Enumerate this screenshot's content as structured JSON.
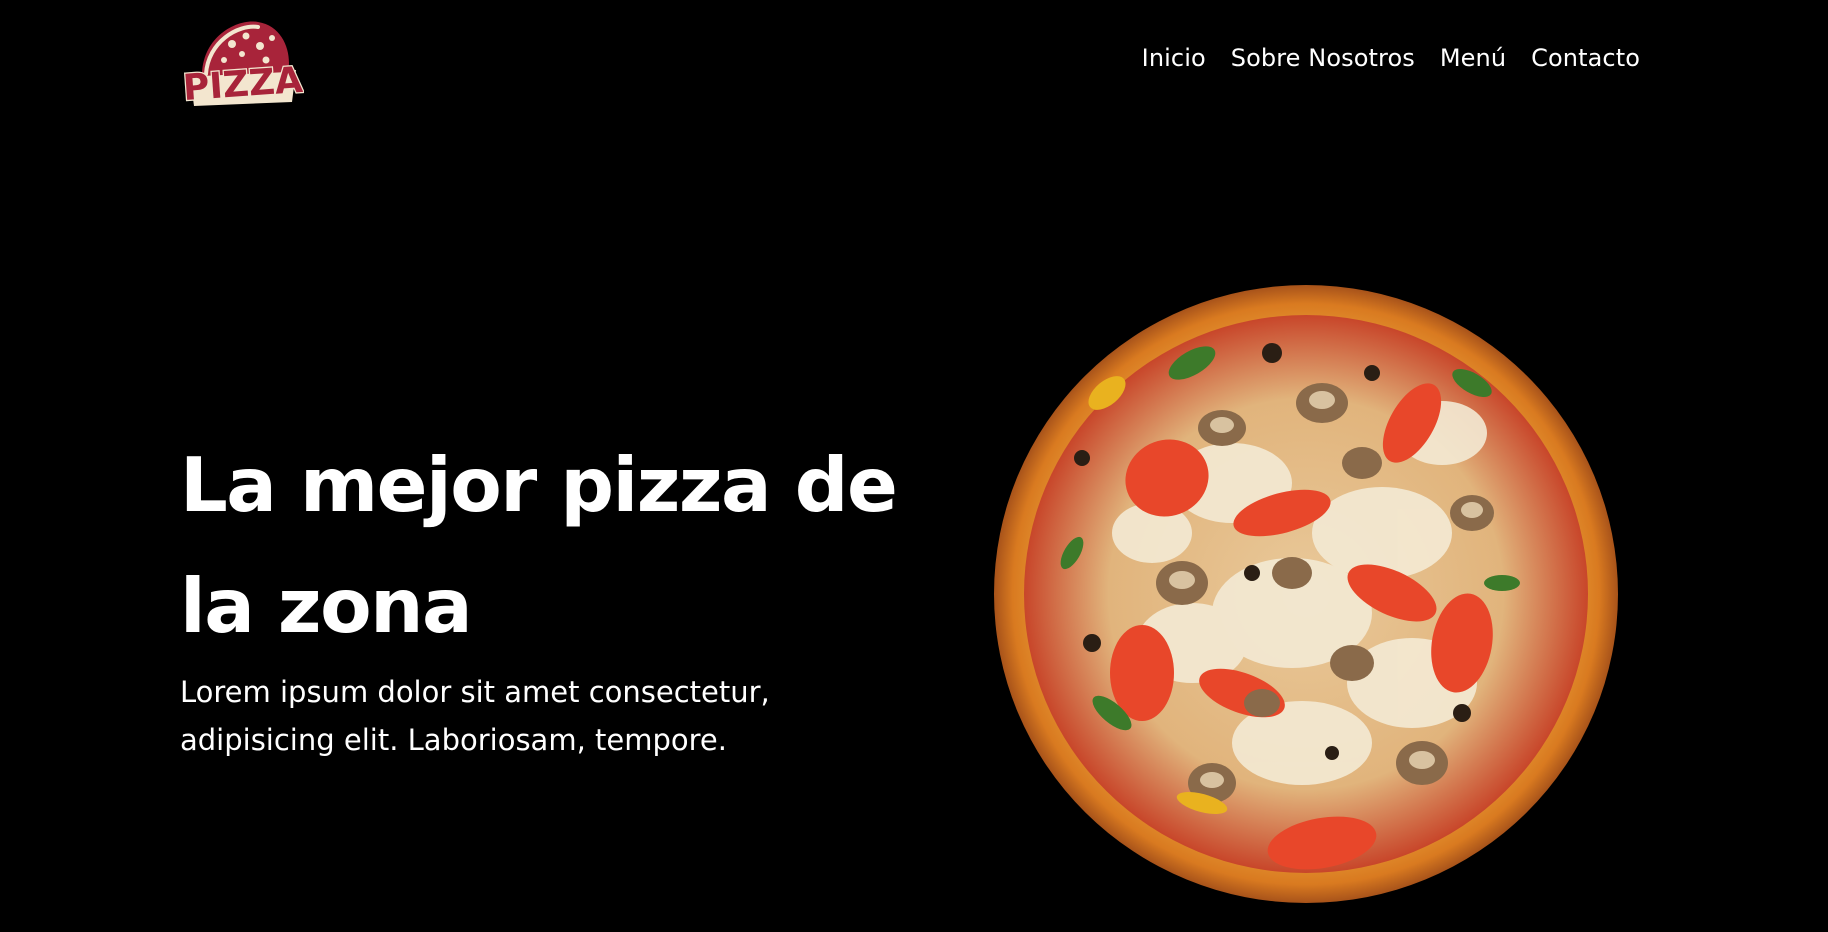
{
  "header": {
    "logo_text": "PIZZA",
    "nav": [
      {
        "label": "Inicio"
      },
      {
        "label": "Sobre Nosotros"
      },
      {
        "label": "Menú"
      },
      {
        "label": "Contacto"
      }
    ]
  },
  "hero": {
    "title": "La mejor pizza de la zona",
    "text": "Lorem ipsum dolor sit amet consectetur, adipisicing elit. Laboriosam, tempore."
  },
  "colors": {
    "background": "#000000",
    "text": "#ffffff",
    "logo_red": "#a8243a",
    "logo_cream": "#f3e6cf"
  }
}
